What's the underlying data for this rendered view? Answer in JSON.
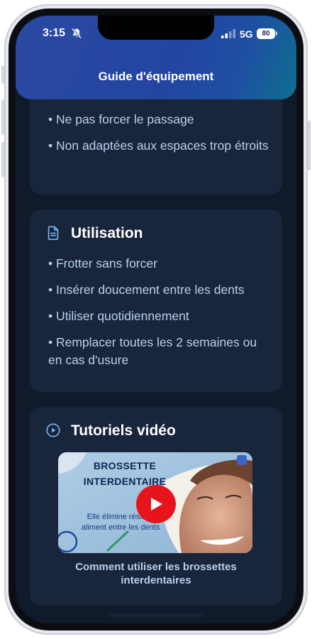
{
  "status_bar": {
    "time": "3:15",
    "network": "5G",
    "battery": "80"
  },
  "header": {
    "title": "Guide d'équipement"
  },
  "precautions": {
    "items": [
      "• Ne pas forcer le passage",
      "• Non adaptées aux espaces trop étroits"
    ]
  },
  "usage": {
    "title": "Utilisation",
    "icon": "document-icon",
    "items": [
      "• Frotter sans forcer",
      "• Insérer doucement entre les dents",
      "• Utiliser quotidiennement",
      "• Remplacer toutes les 2 semaines ou en cas d'usure"
    ]
  },
  "videos": {
    "title": "Tutoriels vidéo",
    "icon": "play-circle-icon",
    "thumbnail": {
      "heading": "BROSSETTE INTERDENTAIRE",
      "subtitle": "Elle élimine résidus aliment entre les dents"
    },
    "caption": "Comment utiliser les brossettes interdentaires"
  },
  "colors": {
    "background": "#0f1a2b",
    "card": "#18253a",
    "header": "#2345a0",
    "bullet_text": "#b9d0ee",
    "play_button": "#e8141c"
  }
}
